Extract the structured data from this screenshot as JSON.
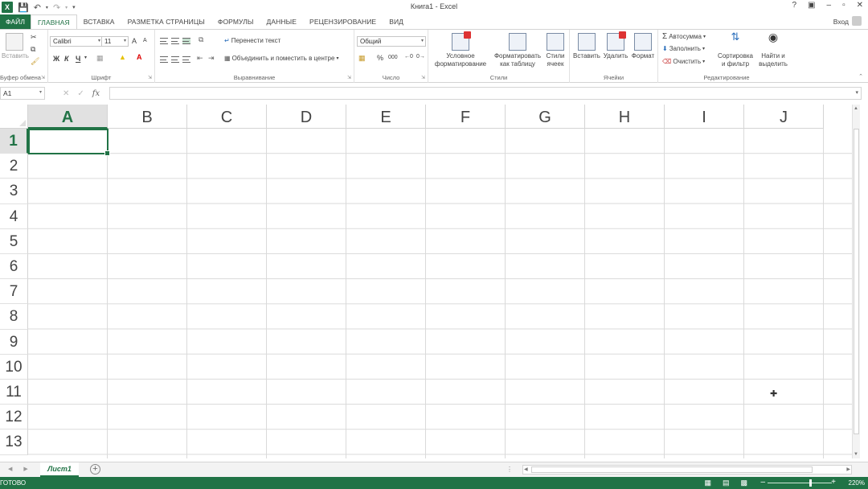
{
  "titlebar": {
    "title": "Книга1 - Excel",
    "app_badge": "X",
    "qa_icons": [
      "save-icon",
      "undo-icon",
      "redo-icon",
      "customize-icon"
    ],
    "controls": [
      "?",
      "▣",
      "–",
      "▫",
      "✕"
    ]
  },
  "tabs": {
    "file": "ФАЙЛ",
    "items": [
      "ГЛАВНАЯ",
      "ВСТАВКА",
      "РАЗМЕТКА СТРАНИЦЫ",
      "ФОРМУЛЫ",
      "ДАННЫЕ",
      "РЕЦЕНЗИРОВАНИЕ",
      "ВИД"
    ],
    "active": "ГЛАВНАЯ",
    "login": "Вход"
  },
  "ribbon": {
    "clipboard": {
      "label": "Буфер обмена",
      "paste": "Вставить"
    },
    "font": {
      "label": "Шрифт",
      "name": "Calibri",
      "size": "11",
      "bold": "Ж",
      "italic": "К",
      "underline": "Ч",
      "grow": "A",
      "shrink": "A"
    },
    "alignment": {
      "label": "Выравнивание",
      "wrap": "Перенести текст",
      "merge": "Объединить и поместить в центре"
    },
    "number": {
      "label": "Число",
      "format": "Общий",
      "percent": "%",
      "thousands": "000"
    },
    "styles": {
      "label": "Стили",
      "conditional_l1": "Условное",
      "conditional_l2": "форматирование",
      "astable_l1": "Форматировать",
      "astable_l2": "как таблицу",
      "cell_l1": "Стили",
      "cell_l2": "ячеек"
    },
    "cells": {
      "label": "Ячейки",
      "insert": "Вставить",
      "delete": "Удалить",
      "format": "Формат"
    },
    "editing": {
      "label": "Редактирование",
      "autosum": "Автосумма",
      "fill": "Заполнить",
      "clear": "Очистить",
      "sort_l1": "Сортировка",
      "sort_l2": "и фильтр",
      "find_l1": "Найти и",
      "find_l2": "выделить"
    }
  },
  "formula_bar": {
    "name_box": "A1",
    "cancel": "✕",
    "enter": "✓",
    "fx": "fx",
    "value": ""
  },
  "grid": {
    "columns": [
      "A",
      "B",
      "C",
      "D",
      "E",
      "F",
      "G",
      "H",
      "I",
      "J"
    ],
    "rows": [
      "1",
      "2",
      "3",
      "4",
      "5",
      "6",
      "7",
      "8",
      "9",
      "10",
      "11",
      "12",
      "13"
    ],
    "active_cell": "A1"
  },
  "sheets": {
    "tabs": [
      "Лист1"
    ],
    "active": "Лист1",
    "add": "+"
  },
  "status": {
    "text": "ГОТОВО",
    "zoom": "220%",
    "accent": "#217346"
  }
}
